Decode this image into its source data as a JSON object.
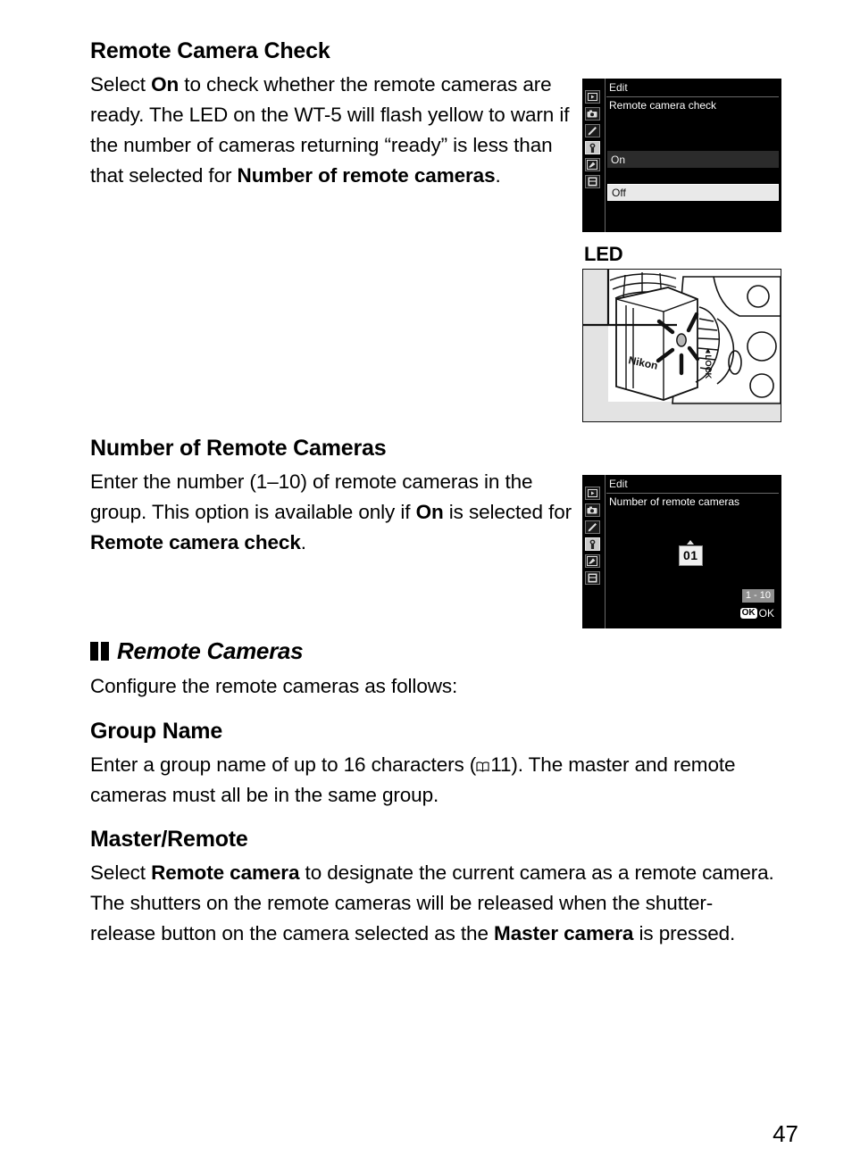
{
  "page": {
    "number": "47"
  },
  "sections": {
    "remote_camera_check": {
      "heading": "Remote Camera Check",
      "body_pre": "Select ",
      "body_bold1": "On",
      "body_mid": " to check whether the remote cameras are ready. The LED on the WT-5 will flash yellow to warn if the number of cameras returning “ready” is less than that selected for ",
      "body_bold2": "Number of remote cameras",
      "body_end": "."
    },
    "number_of_remote_cameras": {
      "heading": "Number of Remote Cameras",
      "body_pre": "Enter the number (1–10) of remote cameras in the group. This option is available only if ",
      "body_bold1": "On",
      "body_mid": " is selected for ",
      "body_bold2": "Remote camera check",
      "body_end": "."
    },
    "remote_cameras": {
      "marker_title": "Remote Cameras",
      "intro": "Configure the remote cameras as follows:"
    },
    "group_name": {
      "heading": "Group Name",
      "body_pre": "Enter a group name of up to 16 characters (",
      "ref_page": "11",
      "body_end": "). The master and remote cameras must all be in the same group."
    },
    "master_remote": {
      "heading": "Master/Remote",
      "body_pre": "Select ",
      "body_bold1": "Remote camera",
      "body_mid": " to designate the current camera as a remote camera. The shutters on the remote cameras will be released when the shutter-release button on the camera selected as the ",
      "body_bold2": "Master camera",
      "body_end": " is pressed."
    }
  },
  "lcd_remote_camera_check": {
    "title": "Edit",
    "subtitle": "Remote camera check",
    "options": [
      {
        "label": "On",
        "state": "normal"
      },
      {
        "label": "Off",
        "state": "selected"
      }
    ],
    "rail_icons": [
      "playback-icon",
      "shooting-menu-icon",
      "custom-settings-pencil-icon",
      "setup-wrench-icon",
      "retouch-icon",
      "recent-settings-icon"
    ],
    "active_rail_index": 3
  },
  "lcd_number_of_remote_cameras": {
    "title": "Edit",
    "subtitle": "Number of remote cameras",
    "value": "01",
    "range_badge": "1 - 10",
    "ok_glyph": "OK",
    "ok_label": "OK",
    "rail_icons": [
      "playback-icon",
      "shooting-menu-icon",
      "custom-settings-pencil-icon",
      "setup-wrench-icon",
      "retouch-icon",
      "recent-settings-icon"
    ],
    "active_rail_index": 3
  },
  "illustration": {
    "callout_label": "LED",
    "brand_text": "Nikon",
    "lock_text": "LOCK"
  },
  "colors": {
    "lcd_background": "#000000",
    "lcd_selected_row": "#e9e9e9",
    "lcd_dim_row": "#2b2b2b",
    "text": "#000000",
    "page_background": "#ffffff"
  }
}
